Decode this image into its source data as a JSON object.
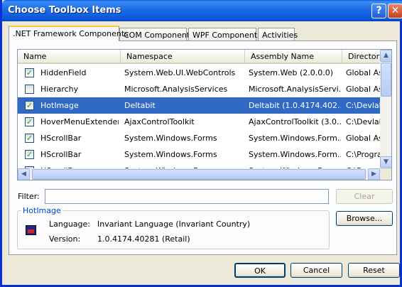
{
  "window": {
    "title": "Choose Toolbox Items",
    "help_glyph": "?",
    "close_glyph": "✕"
  },
  "tabs": [
    {
      "label": ".NET Framework Components",
      "active": true
    },
    {
      "label": "COM Components",
      "active": false
    },
    {
      "label": "WPF Components",
      "active": false
    },
    {
      "label": "Activities",
      "active": false
    }
  ],
  "list": {
    "columns": [
      "Name",
      "Namespace",
      "Assembly Name",
      "Directory"
    ],
    "rows": [
      {
        "checked": true,
        "name": "HiddenField",
        "namespace": "System.Web.UI.WebControls",
        "assembly": "System.Web (2.0.0.0)",
        "directory": "Global Assembly Cache"
      },
      {
        "checked": false,
        "name": "Hierarchy",
        "namespace": "Microsoft.AnalysisServices",
        "assembly": "Microsoft.AnalysisServi...",
        "directory": "Global Assembly Cache"
      },
      {
        "checked": true,
        "name": "HotImage",
        "namespace": "Deltabit",
        "assembly": "Deltabit (1.0.4174.402...",
        "directory": "C:\\Devlab",
        "selected": true
      },
      {
        "checked": true,
        "name": "HoverMenuExtender",
        "namespace": "AjaxControlToolkit",
        "assembly": "AjaxControlToolkit (3.0...",
        "directory": "C:\\Devlab"
      },
      {
        "checked": true,
        "name": "HScrollBar",
        "namespace": "System.Windows.Forms",
        "assembly": "System.Windows.Form...",
        "directory": "Global Assembly Cache"
      },
      {
        "checked": true,
        "name": "HScrollBar",
        "namespace": "System.Windows.Forms",
        "assembly": "System.Windows.Form...",
        "directory": "C:\\Program Files"
      },
      {
        "checked": true,
        "name": "HScrollBar",
        "namespace": "System.Windows.Forms",
        "assembly": "System.Windows.Form...",
        "directory": "C:\\Program Files"
      }
    ]
  },
  "filter": {
    "label": "Filter:",
    "value": "",
    "clear_label": "Clear"
  },
  "details": {
    "group_title": "HotImage",
    "language_label": "Language:",
    "language_value": "Invariant Language (Invariant Country)",
    "version_label": "Version:",
    "version_value": "1.0.4174.40281 (Retail)"
  },
  "buttons": {
    "browse": "Browse...",
    "ok": "OK",
    "cancel": "Cancel",
    "reset": "Reset"
  },
  "colors": {
    "selection": "#316ac5",
    "title_bar": "#0a58da",
    "group_title": "#0046d5"
  }
}
